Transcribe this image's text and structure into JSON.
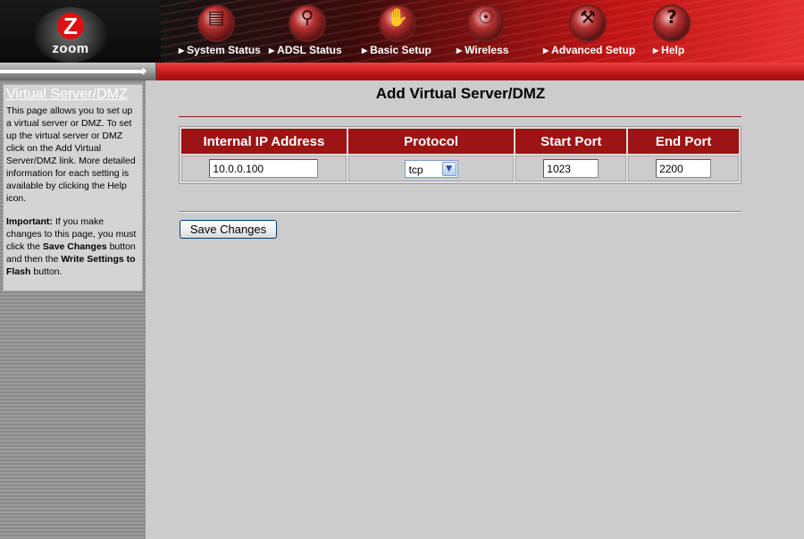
{
  "header": {
    "logo_text": "zoom",
    "logo_mark": "Z",
    "nav": [
      {
        "label": "System Status",
        "icon": "folder-icon"
      },
      {
        "label": "ADSL Status",
        "icon": "magnifier-icon"
      },
      {
        "label": "Basic Setup",
        "icon": "hand-icon"
      },
      {
        "label": "Wireless",
        "icon": "antenna-icon"
      },
      {
        "label": "Advanced Setup",
        "icon": "wrench-icon"
      },
      {
        "label": "Help",
        "icon": "question-icon"
      }
    ]
  },
  "sidebar": {
    "title": "Virtual Server/DMZ",
    "body": "This page allows you to set up a virtual server or DMZ. To set up the virtual server or DMZ click on the Add Virtual Server/DMZ link. More detailed information for each setting is available by clicking the Help icon.",
    "important_label": "Important:",
    "important_text_1": " If you make changes to this page, you must click the ",
    "save_changes_label": "Save Changes",
    "important_text_2": " button and then the ",
    "write_flash_label": "Write Settings to Flash",
    "important_text_3": " button."
  },
  "main": {
    "title": "Add Virtual Server/DMZ",
    "table": {
      "headers": [
        "Internal IP Address",
        "Protocol",
        "Start Port",
        "End Port"
      ],
      "row": {
        "ip": "10.0.0.100",
        "protocol": "tcp",
        "start_port": "1023",
        "end_port": "2200"
      }
    },
    "save_button": "Save Changes"
  },
  "colors": {
    "accent_red": "#9c1414",
    "background": "#cccccc"
  }
}
